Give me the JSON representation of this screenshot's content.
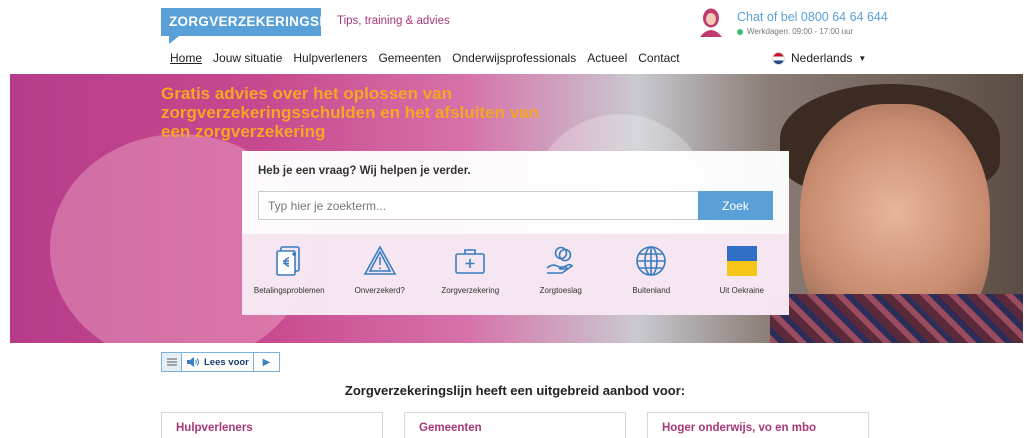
{
  "header": {
    "logo_text": "ZORGVERZEKERINGSLIJN",
    "tagline": "Tips, training & advies",
    "chat_text": "Chat of bel 0800 64 64 644",
    "hours_text": "Werkdagen: 09:00 - 17:00 uur"
  },
  "nav": {
    "items": [
      "Home",
      "Jouw situatie",
      "Hulpverleners",
      "Gemeenten",
      "Onderwijsprofessionals",
      "Actueel",
      "Contact"
    ],
    "language": "Nederlands"
  },
  "hero": {
    "title": "Gratis advies over het oplossen van zorgverzekeringsschulden en het afsluiten van een zorgverzekering",
    "search_question": "Heb je een vraag? Wij helpen je verder.",
    "search_placeholder": "Typ hier je zoekterm...",
    "search_button": "Zoek",
    "categories": [
      {
        "label": "Betalingsproblemen",
        "icon": "document-euro-icon"
      },
      {
        "label": "Onverzekerd?",
        "icon": "warning-icon"
      },
      {
        "label": "Zorgverzekering",
        "icon": "medical-kit-icon"
      },
      {
        "label": "Zorgtoeslag",
        "icon": "hand-coins-icon"
      },
      {
        "label": "Buitenland",
        "icon": "globe-icon"
      },
      {
        "label": "Uit Oekraine",
        "icon": "ukraine-flag-icon"
      }
    ]
  },
  "readaloud": {
    "label": "Lees voor"
  },
  "offer": {
    "title": "Zorgverzekeringslijn heeft een uitgebreid aanbod voor:",
    "cards": [
      "Hulpverleners",
      "Gemeenten",
      "Hoger onderwijs, vo en mbo"
    ]
  },
  "colors": {
    "brand_blue": "#5aa0d8",
    "brand_magenta": "#a8367a",
    "hero_orange": "#f5a623"
  }
}
